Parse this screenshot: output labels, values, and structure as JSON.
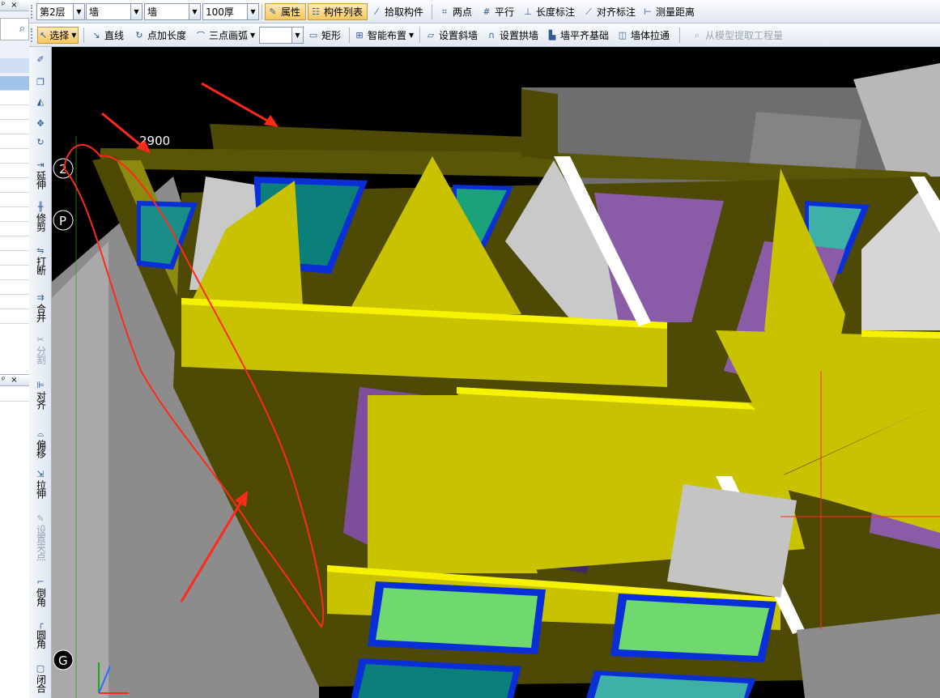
{
  "toolbar1": {
    "floor": "第2层",
    "category": "墙",
    "type": "墙",
    "thickness": "100厚",
    "properties": "属性",
    "component_list": "构件列表",
    "pick_component": "拾取构件",
    "two_points": "两点",
    "parallel": "平行",
    "length_dim": "长度标注",
    "aligned_dim": "对齐标注",
    "measure_distance": "测量距离"
  },
  "toolbar2": {
    "select": "选择",
    "line": "直线",
    "point_add_length": "点加长度",
    "three_point_arc": "三点画弧",
    "rectangle": "矩形",
    "smart_layout": "智能布置",
    "set_sloped_wall": "设置斜墙",
    "set_arch_wall": "设置拱墙",
    "wall_flush_foundation": "墙平齐基础",
    "wall_stretch": "墙体拉通",
    "extract_quantity": "从模型提取工程量"
  },
  "left_panel": {
    "pin": "ᵖ",
    "close": "×"
  },
  "vertical_tools": [
    {
      "label": "延伸",
      "icon": "extend-icon"
    },
    {
      "label": "修剪",
      "icon": "trim-icon"
    },
    {
      "label": "打断",
      "icon": "break-icon"
    },
    {
      "label": "合并",
      "icon": "merge-icon"
    },
    {
      "label": "分割",
      "icon": "split-icon"
    },
    {
      "label": "对齐",
      "icon": "align-icon"
    },
    {
      "label": "偏移",
      "icon": "offset-icon"
    },
    {
      "label": "拉伸",
      "icon": "stretch-icon"
    },
    {
      "label": "设置夹点",
      "icon": "grip-point-icon"
    },
    {
      "label": "倒角",
      "icon": "chamfer-icon"
    },
    {
      "label": "圆角",
      "icon": "fillet-icon"
    },
    {
      "label": "闭合",
      "icon": "close-shape-icon"
    }
  ],
  "viewport": {
    "dimension_label": "2900",
    "axis_labels": [
      "2",
      "P",
      "G"
    ],
    "colors": {
      "wall_yellow": "#c8c200",
      "wall_highlight": "#f6f200",
      "wall_dark": "#4e4a05",
      "window_blue": "#0a2fd6",
      "glass_teal": "#0b7f7a",
      "glass_green": "#6fd86f",
      "opening_purple": "#8a5ca8",
      "wall_grey": "#8c8c8c",
      "annotation_red": "#ff2a1a"
    }
  }
}
